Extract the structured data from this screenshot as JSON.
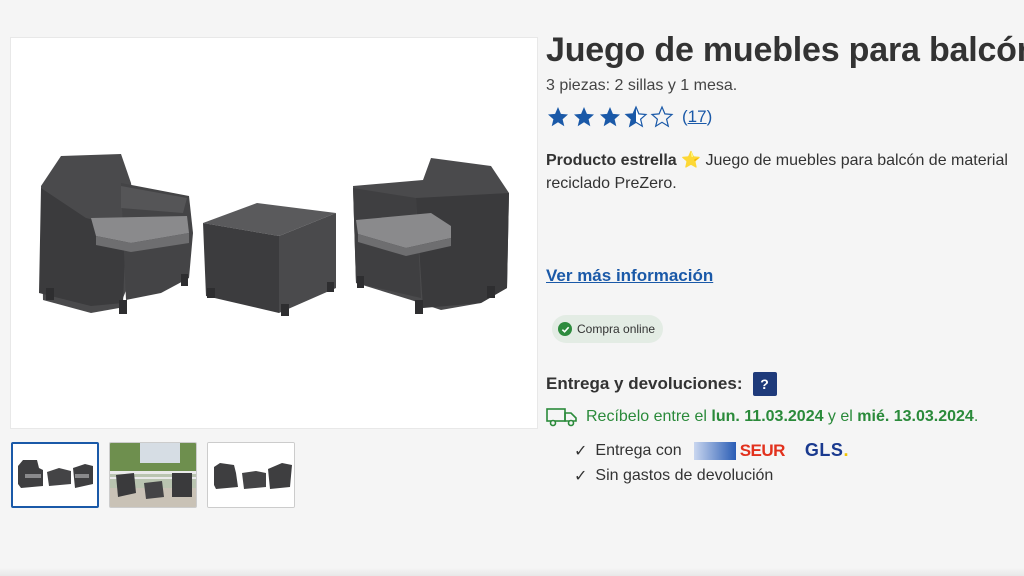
{
  "product": {
    "title": "Juego de muebles para balcón",
    "subtitle": "3 piezas: 2 sillas y 1 mesa.",
    "rating": {
      "value": 3.5,
      "max": 5,
      "count": "17"
    },
    "highlight_label": "Producto estrella",
    "highlight_emoji": "⭐",
    "highlight_text": " Juego de muebles para balcón de material reciclado PreZero.",
    "more_info_link": "Ver más información",
    "online_badge": "Compra online"
  },
  "delivery": {
    "title": "Entrega y devoluciones:",
    "help_label": "?",
    "receive_prefix": "Recíbelo entre el ",
    "date_start": "lun. 11.03.2024",
    "receive_middle": " y el ",
    "date_end": "mié. 13.03.2024",
    "receive_suffix": ".",
    "bullets": [
      {
        "check": "✓",
        "text": "Entrega con"
      },
      {
        "check": "✓",
        "text": "Sin gastos de devolución"
      }
    ],
    "carriers": {
      "seur": "SEUR",
      "gls": "GLS",
      "gls_dot": "."
    }
  },
  "gallery": {
    "thumbnails": [
      "furniture-set",
      "furniture-on-balcony",
      "furniture-set-alt"
    ],
    "active_index": 0
  },
  "colors": {
    "accent": "#1a59a8",
    "star": "#1a59a8",
    "success": "#2a8a3a",
    "help": "#1e3a7a"
  }
}
